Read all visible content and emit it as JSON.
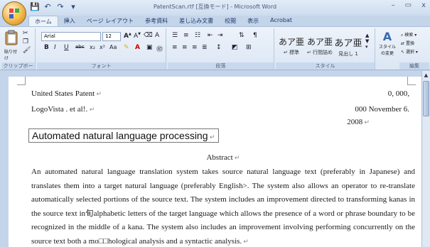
{
  "window": {
    "title": "PatentScan.rtf [互換モード] - Microsoft Word",
    "minimize": "–",
    "maximize": "▭",
    "close": "x"
  },
  "quick_access": [
    "💾",
    "↶",
    "↷",
    "▾"
  ],
  "tabs": [
    "ホーム",
    "挿入",
    "ページ レイアウト",
    "参考資料",
    "差し込み文書",
    "校閲",
    "表示",
    "Acrobat"
  ],
  "ribbon": {
    "clipboard": {
      "paste_label": "貼り付け",
      "group_label": "クリップボード"
    },
    "font": {
      "font_name": "Arial",
      "font_size": "12",
      "group_label": "フォント"
    },
    "paragraph": {
      "group_label": "段落"
    },
    "styles": {
      "group_label": "スタイル",
      "items": [
        {
          "sample": "あア亜",
          "name": "↵ 標準"
        },
        {
          "sample": "あア亜",
          "name": "↵ 行間詰め"
        },
        {
          "sample": "あア亜",
          "name": "見出し 1"
        }
      ],
      "change_styles": "スタイルの変更"
    },
    "editing": {
      "group_label": "編集",
      "find": "検索 ▾",
      "replace": "置換",
      "select": "選択 ▾"
    }
  },
  "document": {
    "patent_line": "United States Patent",
    "number": "0,  000,",
    "author": "LogoVista . et al!. ",
    "date_line1": "000 November 6.",
    "date_line2": "2008",
    "heading": "Automated natural language processing",
    "abstract_title": "Abstract",
    "abstract_body": "An automated natural language translation system takes source natural language text (preferably in Japanese) and translates them into a target natural language (preferably English>. The system also allows an operator to re-translate automatically selected portions of the source text. The system includes an improvement directed to transforming kanas in the source text in旬alphabetic letters of the target language which allows the presence of a word or phrase boundary to be recognized in the middle of a kana. The system also includes an improvement involving performing concurrently on the source text both a mo□□hological analysis and a syntactic analysis."
  }
}
